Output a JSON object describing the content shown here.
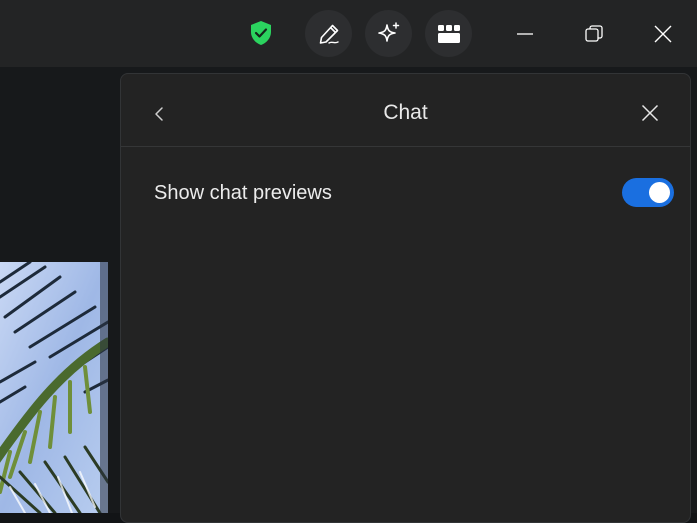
{
  "titlebar": {
    "shield_icon": "shield-check-icon",
    "shield_color": "#2bd35f",
    "buttons": [
      {
        "name": "edit",
        "icon": "pen-icon"
      },
      {
        "name": "ai-sparkle",
        "icon": "sparkle-icon"
      },
      {
        "name": "apps",
        "icon": "apps-grid-icon"
      }
    ],
    "window_controls": [
      "minimize-icon",
      "restore-icon",
      "close-icon"
    ]
  },
  "panel": {
    "title": "Chat",
    "back_icon": "chevron-left-icon",
    "close_icon": "close-icon",
    "settings": [
      {
        "label": "Show chat previews",
        "enabled": true
      }
    ]
  },
  "colors": {
    "accent": "#1a6fe0",
    "panel_bg": "#232323",
    "titlebar_bg": "#232425"
  }
}
